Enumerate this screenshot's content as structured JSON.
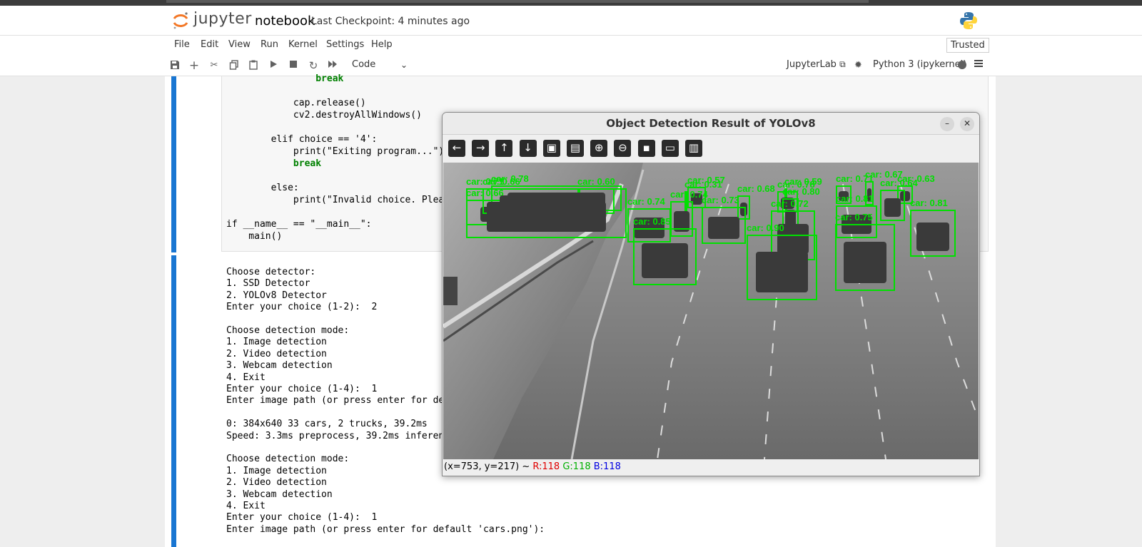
{
  "app": {
    "logo_text": "jupyter",
    "notebook_name": "notebook",
    "checkpoint": "Last Checkpoint: 4 minutes ago",
    "trusted": "Trusted"
  },
  "menu": [
    "File",
    "Edit",
    "View",
    "Run",
    "Kernel",
    "Settings",
    "Help"
  ],
  "toolbar": {
    "buttons": [
      "save-icon",
      "add-icon",
      "cut-icon",
      "copy-icon",
      "paste-icon",
      "run-icon",
      "stop-icon",
      "restart-icon",
      "fast-forward-icon"
    ],
    "cell_type": "Code",
    "jupyterlab_label": "JupyterLab",
    "kernel_label": "Python 3 (ipykernel)"
  },
  "code_lines": [
    "                break",
    "",
    "            cap.release()",
    "            cv2.destroyAllWindows()",
    "",
    "        elif choice == '4':",
    "            print(\"Exiting program...\")",
    "            break",
    "",
    "        else:",
    "            print(\"Invalid choice. Please",
    "",
    "if __name__ == \"__main__\":",
    "    main()"
  ],
  "output_lines": [
    "Choose detector:",
    "1. SSD Detector",
    "2. YOLOv8 Detector",
    "Enter your choice (1-2):  2",
    "",
    "Choose detection mode:",
    "1. Image detection",
    "2. Video detection",
    "3. Webcam detection",
    "4. Exit",
    "Enter your choice (1-4):  1",
    "Enter image path (or press enter for def",
    "",
    "0: 384x640 33 cars, 2 trucks, 39.2ms",
    "Speed: 3.3ms preprocess, 39.2ms inferenc",
    "",
    "Choose detection mode:",
    "1. Image detection",
    "2. Video detection",
    "3. Webcam detection",
    "4. Exit",
    "Enter your choice (1-4):  1",
    "Enter image path (or press enter for default 'cars.png'):"
  ],
  "window": {
    "title": "Object Detection Result of YOLOv8",
    "toolbar_icons": [
      "arrow-left-icon",
      "arrow-right-icon",
      "arrow-up-icon",
      "arrow-down-icon",
      "fit-image-icon",
      "image-settings-icon",
      "zoom-in-icon",
      "zoom-out-icon",
      "save-image-icon",
      "copy-clipboard-icon",
      "properties-icon"
    ],
    "status_coords": "(x=753, y=217) ~",
    "status_r": "R:118",
    "status_g": "G:118",
    "status_b": "B:118",
    "box_color": "#00e000"
  },
  "detections": [
    {
      "label": "car: 0.66"
    },
    {
      "label": "car: 0.60"
    },
    {
      "label": "car: 0.66"
    },
    {
      "label": "car: 0.78"
    },
    {
      "label": "car: 0.71"
    },
    {
      "label": "car: 0.31"
    },
    {
      "label": "car: 0.57"
    },
    {
      "label": "car: 0.68"
    },
    {
      "label": "car: 0.59"
    },
    {
      "label": "car: 0.78"
    },
    {
      "label": "car: 0.67"
    },
    {
      "label": "car: 0.63"
    },
    {
      "label": "car: 0.64"
    },
    {
      "label": "car: 0.71"
    },
    {
      "label": "car: 0.74"
    },
    {
      "label": "car: 0.81"
    },
    {
      "label": "car: 0.80"
    },
    {
      "label": "car: 0.74"
    },
    {
      "label": "car: 0.73"
    },
    {
      "label": "car: 0.72"
    },
    {
      "label": "car: 0.81"
    },
    {
      "label": "car: 0.75"
    },
    {
      "label": "car: 0.85"
    },
    {
      "label": "car: 0.90"
    }
  ]
}
